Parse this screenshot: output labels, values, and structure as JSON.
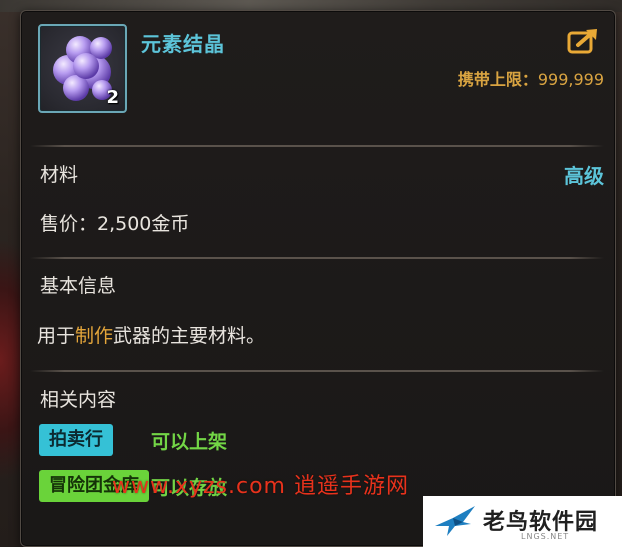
{
  "item": {
    "name": "元素结晶",
    "count": "2",
    "icon": "purple-crystal-cluster-icon",
    "carry_limit_label": "携带上限：",
    "carry_limit_value": "999,999"
  },
  "details": {
    "category": "材料",
    "grade": "高级",
    "price": "售价：2,500金币"
  },
  "basic_info": {
    "heading": "基本信息",
    "desc_before": "用于",
    "desc_highlight": "制作",
    "desc_after": "武器的主要材料。"
  },
  "related": {
    "heading": "相关内容",
    "auction_tag": "拍卖行",
    "auction_note": "可以上架",
    "guild_tag": "冒险团金库",
    "guild_note": "可以存放"
  },
  "watermark": "www.xyzs.com 逍遥手游网",
  "logo": {
    "text": "老鸟软件园",
    "sub": "LNGS.NET"
  },
  "colors": {
    "accent_cyan": "#5cc4d9",
    "gold": "#d9a441",
    "green": "#6ad33a",
    "watermark_red": "#e8321c"
  }
}
